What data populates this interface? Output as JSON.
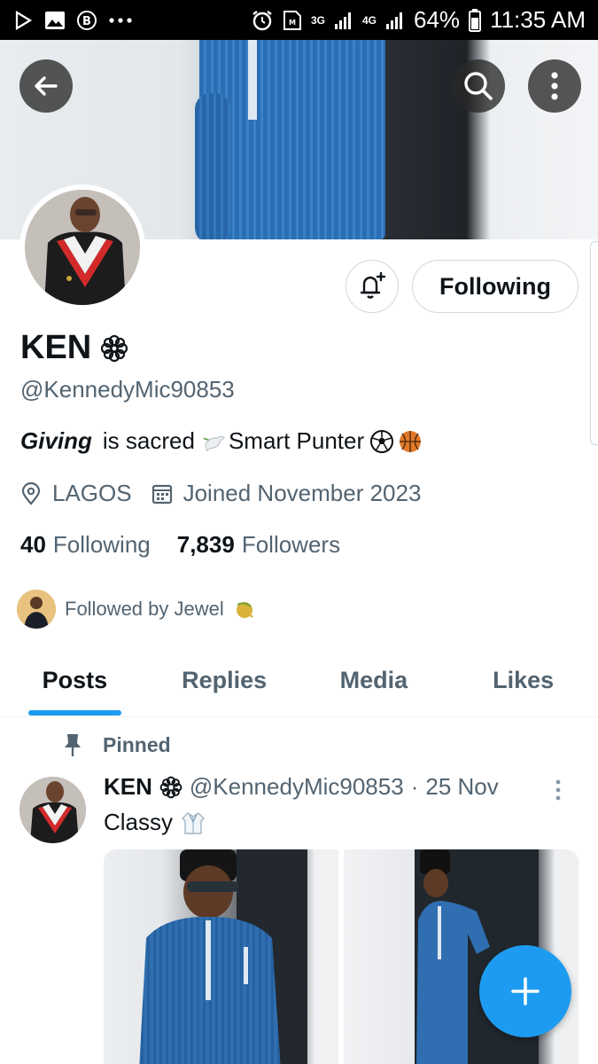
{
  "status_bar": {
    "network1": "3G",
    "network2": "4G",
    "battery": "64%",
    "time": "11:35 AM"
  },
  "profile": {
    "display_name": "KEN",
    "handle": "@KennedyMic90853",
    "bio": {
      "bold_word": "Giving",
      "part1": "is sacred",
      "part2": "Smart  Punter"
    },
    "location": "LAGOS",
    "joined": "Joined November 2023",
    "following_count": "40",
    "following_label": "Following",
    "followers_count": "7,839",
    "followers_label": "Followers",
    "followed_by": "Followed by Jewel"
  },
  "actions": {
    "following_button": "Following"
  },
  "tabs": [
    {
      "label": "Posts",
      "active": true
    },
    {
      "label": "Replies",
      "active": false
    },
    {
      "label": "Media",
      "active": false
    },
    {
      "label": "Likes",
      "active": false
    }
  ],
  "pinned_post": {
    "pinned_label": "Pinned",
    "author_name": "KEN",
    "author_handle": "@KennedyMic90853",
    "separator": "·",
    "date": "25 Nov",
    "text": "Classy"
  },
  "colors": {
    "accent": "#1d9bf0",
    "text_primary": "#0f1419",
    "text_secondary": "#536471",
    "border": "#cfd9de"
  }
}
